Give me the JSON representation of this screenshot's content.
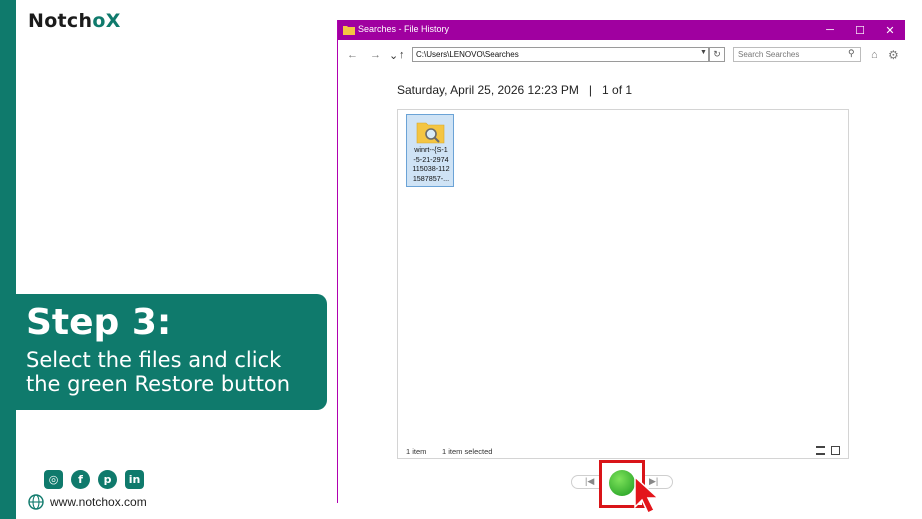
{
  "brand": {
    "name_prefix": "Notch",
    "name_o": "o",
    "name_x": "X"
  },
  "step": {
    "title": "Step 3:",
    "description": "Select the files and click\nthe green Restore button"
  },
  "socials": [
    {
      "icon": "instagram-icon",
      "glyph": "◎"
    },
    {
      "icon": "facebook-icon",
      "glyph": "f"
    },
    {
      "icon": "pinterest-icon",
      "glyph": "p"
    },
    {
      "icon": "linkedin-icon",
      "glyph": "in"
    }
  ],
  "website": {
    "icon": "globe-icon",
    "text": "www.notchox.com"
  },
  "window": {
    "title": "Searches - File History",
    "controls": {
      "minimize": "─",
      "maximize": "☐",
      "close": "✕"
    },
    "address": "C:\\Users\\LENOVO\\Searches",
    "search_placeholder": "Search Searches",
    "date_line": "Saturday, April 25, 2026 12:23 PM   |   1 of 1",
    "file": {
      "name": "winrt--{S-1\n-5-21-2974\n115038-112\n1587857-..."
    },
    "status_count": "1 item",
    "status_selected": "1 item selected"
  },
  "colors": {
    "brand": "#0f7a6c",
    "titlebar": "#a000a0",
    "highlight": "#d91418",
    "restore": "#1c9a20"
  }
}
